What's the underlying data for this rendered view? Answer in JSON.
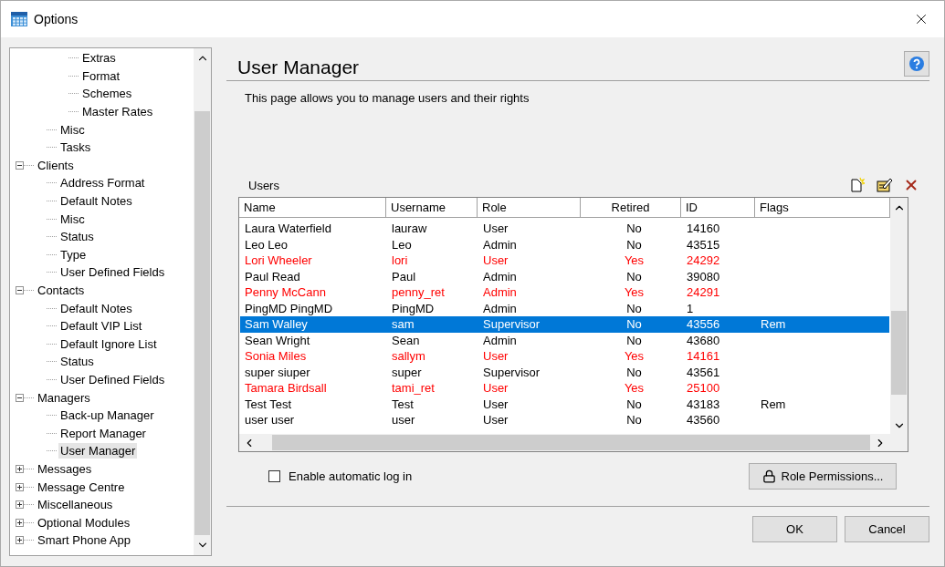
{
  "window": {
    "title": "Options"
  },
  "tree": [
    {
      "children": [
        {
          "children": [
            {
              "label": "Extras",
              "selected": false
            },
            {
              "label": "Format",
              "selected": false
            },
            {
              "label": "Schemes",
              "selected": false
            },
            {
              "label": "Master Rates",
              "selected": false
            }
          ]
        },
        {
          "label": "Misc",
          "selected": false
        },
        {
          "label": "Tasks",
          "selected": false
        }
      ]
    },
    {
      "label": "Clients",
      "selected": false,
      "expanded": true,
      "children": [
        {
          "label": "Address Format",
          "selected": false
        },
        {
          "label": "Default Notes",
          "selected": false
        },
        {
          "label": "Misc",
          "selected": false
        },
        {
          "label": "Status",
          "selected": false
        },
        {
          "label": "Type",
          "selected": false
        },
        {
          "label": "User Defined Fields",
          "selected": false
        }
      ]
    },
    {
      "label": "Contacts",
      "selected": false,
      "expanded": true,
      "children": [
        {
          "label": "Default Notes",
          "selected": false
        },
        {
          "label": "Default VIP List",
          "selected": false
        },
        {
          "label": "Default Ignore List",
          "selected": false
        },
        {
          "label": "Status",
          "selected": false
        },
        {
          "label": "User Defined Fields",
          "selected": false
        }
      ]
    },
    {
      "label": "Managers",
      "selected": false,
      "expanded": true,
      "children": [
        {
          "label": "Back-up Manager",
          "selected": false
        },
        {
          "label": "Report Manager",
          "selected": false
        },
        {
          "label": "User Manager",
          "selected": true
        }
      ]
    },
    {
      "label": "Messages",
      "selected": false,
      "expanded": false
    },
    {
      "label": "Message Centre",
      "selected": false,
      "expanded": false
    },
    {
      "label": "Miscellaneous",
      "selected": false,
      "expanded": false
    },
    {
      "label": "Optional Modules",
      "selected": false,
      "expanded": false
    },
    {
      "label": "Smart Phone App",
      "selected": false,
      "expanded": false
    }
  ],
  "page": {
    "title": "User Manager",
    "description": "This page allows you to manage users and their rights"
  },
  "users": {
    "label": "Users",
    "columns": [
      "Name",
      "Username",
      "Role",
      "Retired",
      "ID",
      "Flags"
    ],
    "rows": [
      {
        "cells": [
          "Laura Waterfield",
          "lauraw",
          "User",
          "No",
          "14160",
          ""
        ],
        "warning": false,
        "selected": false
      },
      {
        "cells": [
          "Leo Leo",
          "Leo",
          "Admin",
          "No",
          "43515",
          ""
        ],
        "warning": false,
        "selected": false
      },
      {
        "cells": [
          "Lori Wheeler",
          "lori",
          "User",
          "Yes",
          "24292",
          ""
        ],
        "warning": true,
        "selected": false
      },
      {
        "cells": [
          "Paul Read",
          "Paul",
          "Admin",
          "No",
          "39080",
          ""
        ],
        "warning": false,
        "selected": false
      },
      {
        "cells": [
          "Penny McCann",
          "penny_ret",
          "Admin",
          "Yes",
          "24291",
          ""
        ],
        "warning": true,
        "selected": false
      },
      {
        "cells": [
          "PingMD PingMD",
          "PingMD",
          "Admin",
          "No",
          "1",
          ""
        ],
        "warning": false,
        "selected": false
      },
      {
        "cells": [
          "Sam Walley",
          "sam",
          "Supervisor",
          "No",
          "43556",
          "Rem"
        ],
        "warning": false,
        "selected": true
      },
      {
        "cells": [
          "Sean Wright",
          "Sean",
          "Admin",
          "No",
          "43680",
          ""
        ],
        "warning": false,
        "selected": false
      },
      {
        "cells": [
          "Sonia Miles",
          "sallym",
          "User",
          "Yes",
          "14161",
          ""
        ],
        "warning": true,
        "selected": false
      },
      {
        "cells": [
          "super siuper",
          "super",
          "Supervisor",
          "No",
          "43561",
          ""
        ],
        "warning": false,
        "selected": false
      },
      {
        "cells": [
          "Tamara Birdsall",
          "tami_ret",
          "User",
          "Yes",
          "25100",
          ""
        ],
        "warning": true,
        "selected": false
      },
      {
        "cells": [
          "Test Test",
          "Test",
          "User",
          "No",
          "43183",
          "Rem"
        ],
        "warning": false,
        "selected": false
      },
      {
        "cells": [
          "user user",
          "user",
          "User",
          "No",
          "43560",
          ""
        ],
        "warning": false,
        "selected": false
      }
    ]
  },
  "auto_login": {
    "label": "Enable automatic log in",
    "checked": false
  },
  "role_button": "Role Permissions...",
  "buttons": [
    "OK",
    "Cancel"
  ]
}
